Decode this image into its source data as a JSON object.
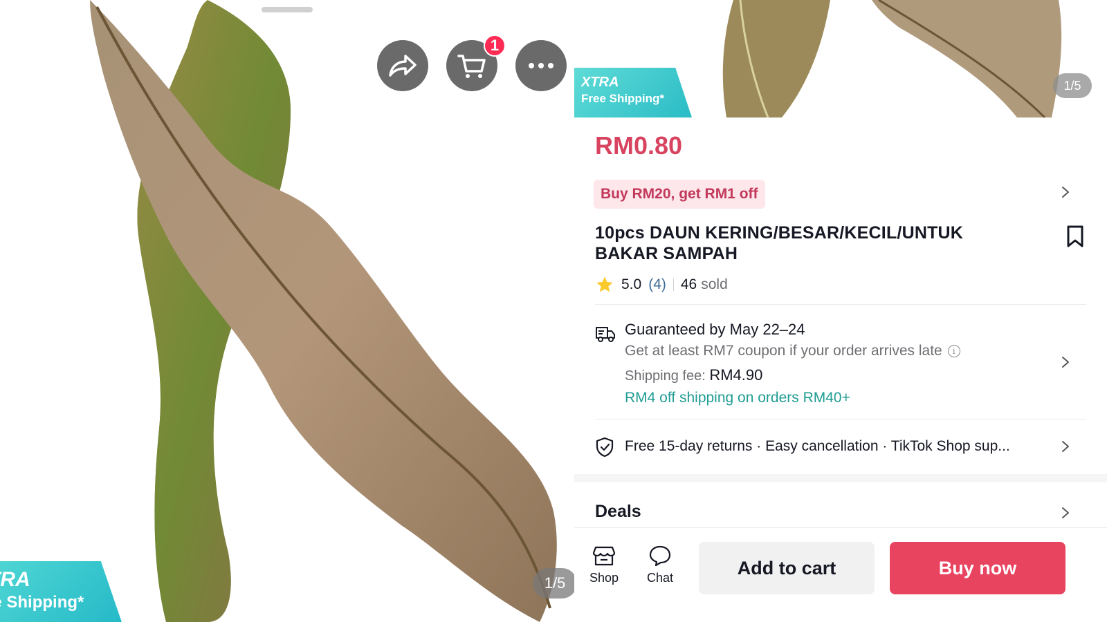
{
  "image_gallery": {
    "counter": "1/5",
    "badge": {
      "line1": "XTRA",
      "line2": "Free Shipping*"
    },
    "left_badge": {
      "line1": "TRA",
      "line2": "ee Shipping*"
    },
    "cart_count": "1",
    "top_actions": [
      "share-icon",
      "cart-icon",
      "more-icon"
    ]
  },
  "product": {
    "price": "RM0.80",
    "promo": "Buy RM20, get RM1 off",
    "title": "10pcs DAUN KERING/BESAR/KECIL/UNTUK BAKAR SAMPAH",
    "rating": "5.0",
    "review_count": "(4)",
    "sold_count": "46",
    "sold_label": "sold"
  },
  "shipping": {
    "guarantee": "Guaranteed by May 22–24",
    "late_coupon": "Get at least RM7 coupon if your order arrives late",
    "fee_label": "Shipping fee:",
    "fee_value": "RM4.90",
    "discount": "RM4 off shipping on orders RM40+"
  },
  "returns": {
    "text": "Free 15-day returns · Easy cancellation · TikTok Shop sup..."
  },
  "deals": {
    "label": "Deals"
  },
  "bottom_bar": {
    "shop": "Shop",
    "chat": "Chat",
    "add_to_cart": "Add to cart",
    "buy_now": "Buy now"
  },
  "colors": {
    "price": "#d8435f",
    "buy_now": "#e8435f",
    "badge_teal": "#2bbcc6",
    "link_teal": "#1f9c94",
    "promo_bg": "#fde7ea"
  }
}
